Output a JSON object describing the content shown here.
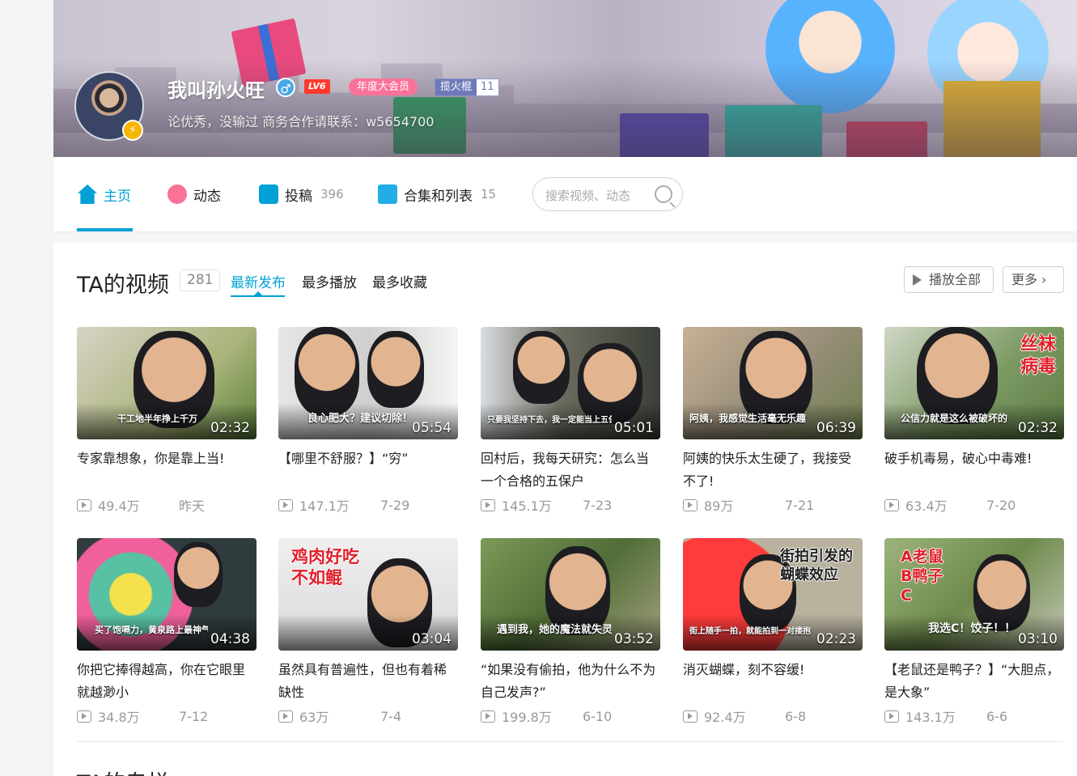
{
  "profile": {
    "name": "我叫孙火旺",
    "level": "LV6",
    "vip_label": "年度大会员",
    "medal_name": "揽火棍",
    "medal_level": "11",
    "sign": "论优秀，没输过 商务合作请联系：w5654700"
  },
  "nav": {
    "home": "主页",
    "dynamic": "动态",
    "posts": "投稿",
    "posts_count": "396",
    "collections": "合集和列表",
    "collections_count": "15",
    "search_placeholder": "搜索视频、动态"
  },
  "videos_section": {
    "title": "TA的视频",
    "count": "281",
    "tabs": [
      "最新发布",
      "最多播放",
      "最多收藏"
    ],
    "play_all": "播放全部",
    "more": "更多"
  },
  "videos": [
    {
      "title": "专家靠想象，你是靠上当!",
      "caption": "干工地半年挣上千万",
      "duration": "02:32",
      "views": "49.4万",
      "date": "昨天"
    },
    {
      "title": "【哪里不舒服？】“穷”",
      "caption": "良心肥大？建议切除！",
      "duration": "05:54",
      "views": "147.1万",
      "date": "7-29"
    },
    {
      "title": "回村后，我每天研究：怎么当一个合格的五保户",
      "caption": "只要我坚持下去，我一定能当上五保户",
      "duration": "05:01",
      "views": "145.1万",
      "date": "7-23"
    },
    {
      "title": "阿姨的快乐太生硬了，我接受不了!",
      "caption": "阿姨，我感觉生活毫无乐趣",
      "duration": "06:39",
      "views": "89万",
      "date": "7-21"
    },
    {
      "title": "破手机毒易，破心中毒难!",
      "caption": "公信力就是这么被破坏的",
      "big": "丝袜\n病毒",
      "duration": "02:32",
      "views": "63.4万",
      "date": "7-20"
    },
    {
      "title": "你把它捧得越高，你在它眼里就越渺小",
      "caption": "买了饱嗝力，黄泉路上最神气！",
      "duration": "04:38",
      "views": "34.8万",
      "date": "7-12"
    },
    {
      "title": "虽然具有普遍性，但也有着稀缺性",
      "caption": "",
      "big": "鸡肉好吃\n不如鲲",
      "duration": "03:04",
      "views": "63万",
      "date": "7-4"
    },
    {
      "title": "“如果没有偷拍，他为什么不为自己发声?”",
      "caption": "遇到我，她的魔法就失灵了",
      "duration": "03:52",
      "views": "199.8万",
      "date": "6-10"
    },
    {
      "title": "消灭蝴蝶，刻不容缓!",
      "caption": "街上随手一拍，就能拍到一对搂抱",
      "big": "街拍引发的\n蝴蝶效应",
      "duration": "02:23",
      "views": "92.4万",
      "date": "6-8"
    },
    {
      "title": "【老鼠还是鸭子？】“大胆点，是大象”",
      "caption": "我选C！饺子！！",
      "big": "A老鼠\nB鸭子\nC",
      "duration": "03:10",
      "views": "143.1万",
      "date": "6-6"
    }
  ],
  "next_section_title": "TA的专栏",
  "colors": {
    "accent": "#00a1d6",
    "pink": "#fb7299"
  }
}
